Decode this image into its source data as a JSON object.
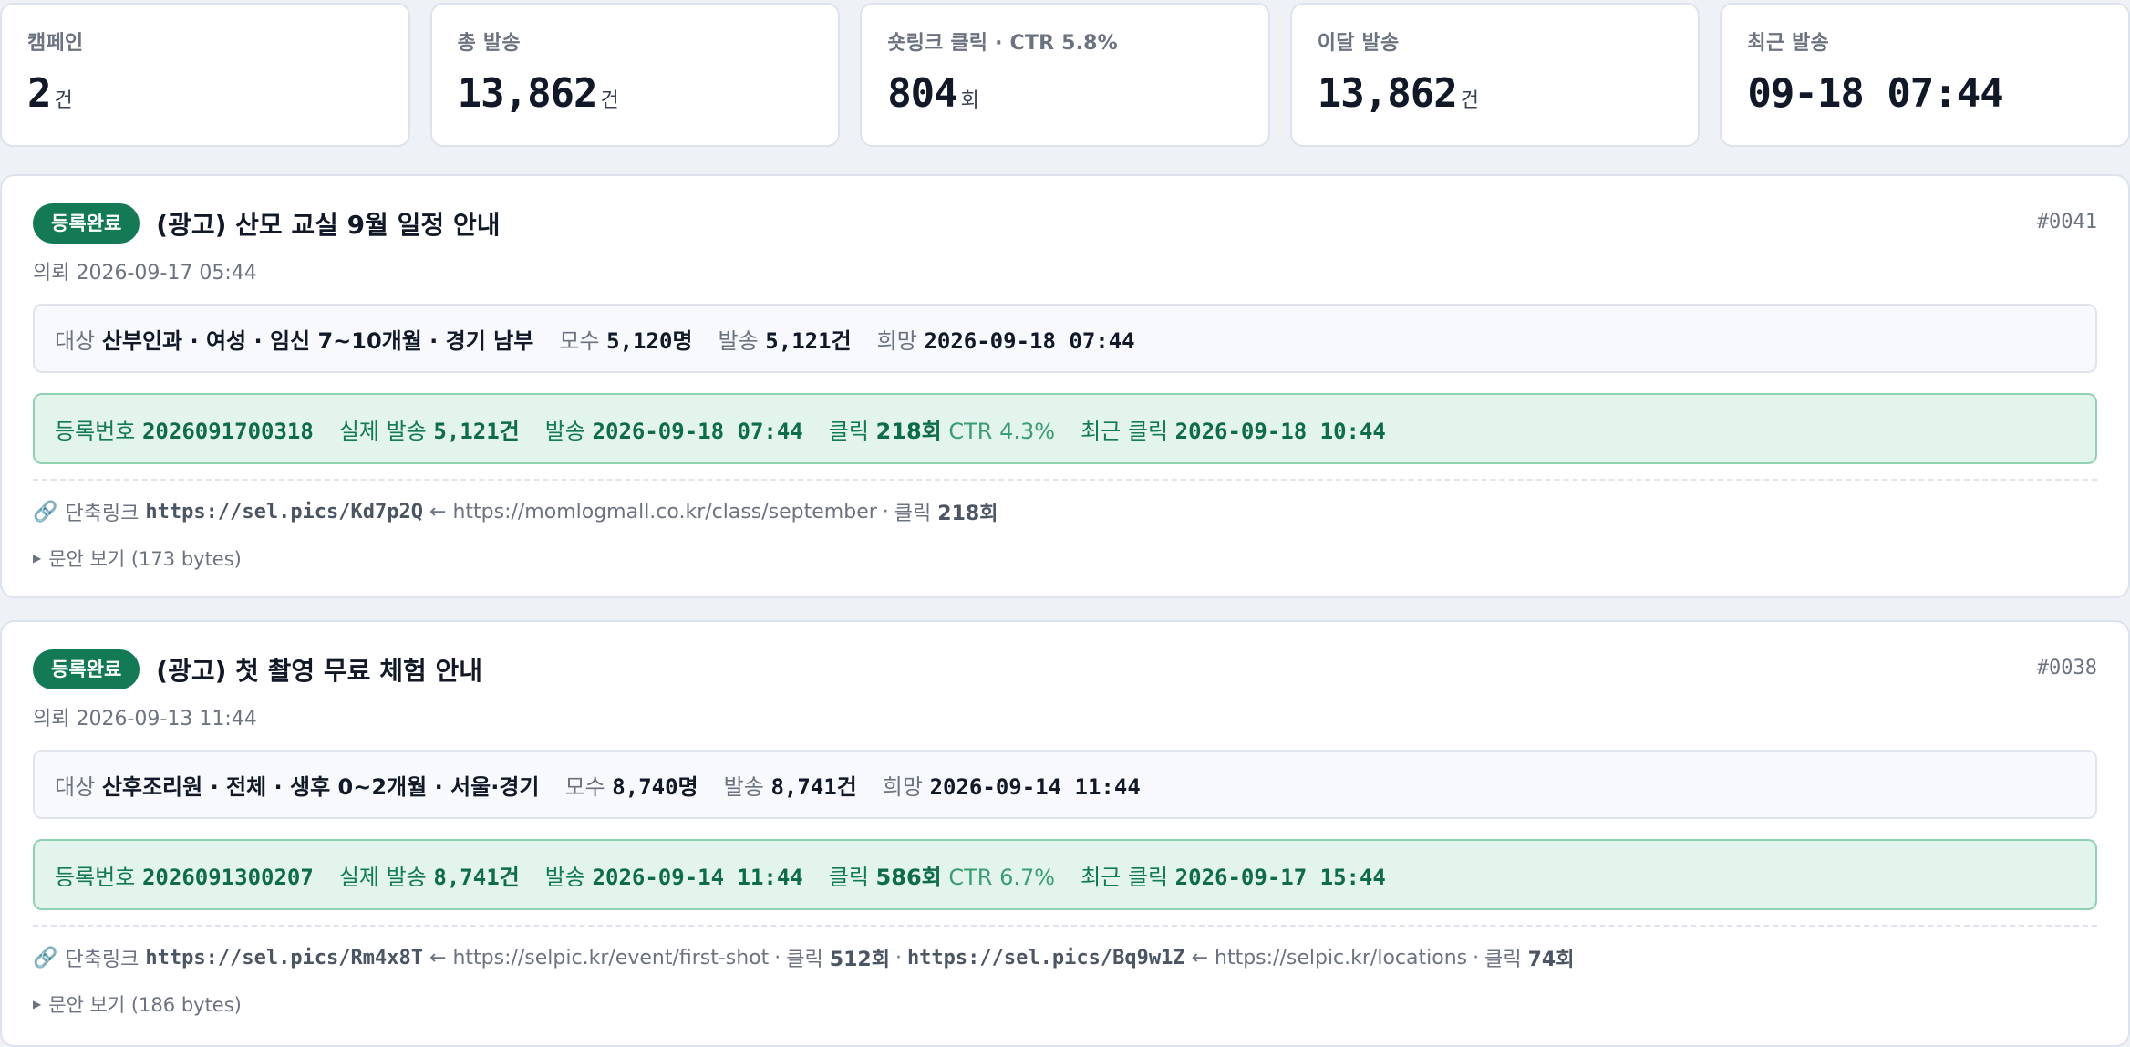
{
  "stats": [
    {
      "label": "캠페인",
      "value": "2",
      "unit": "건"
    },
    {
      "label": "총 발송",
      "value": "13,862",
      "unit": "건"
    },
    {
      "label": "숏링크 클릭 · CTR 5.8%",
      "value": "804",
      "unit": "회"
    },
    {
      "label": "이달 발송",
      "value": "13,862",
      "unit": "건"
    },
    {
      "label": "최근 발송",
      "value": "09-18 07:44",
      "unit": ""
    }
  ],
  "campaigns": [
    {
      "status": "등록완료",
      "title": "(광고) 산모 교실 9월 일정 안내",
      "id": "#0041",
      "requested": "의뢰 2026-09-17 05:44",
      "target_label": "대상",
      "target": "산부인과 · 여성 · 임신 7~10개월 · 경기 남부",
      "population_label": "모수",
      "population": "5,120명",
      "send_label": "발송",
      "send": "5,121건",
      "desired_label": "희망",
      "desired": "2026-09-18 07:44",
      "reg_label": "등록번호",
      "reg_no": "2026091700318",
      "actual_label": "실제 발송",
      "actual": "5,121건",
      "sent_label": "발송",
      "sent_at": "2026-09-18 07:44",
      "click_label": "클릭",
      "clicks": "218회",
      "ctr": "CTR 4.3%",
      "last_click_label": "최근 클릭",
      "last_click": "2026-09-18 10:44",
      "links_label": "단축링크",
      "links": [
        {
          "short": "https://sel.pics/Kd7p2Q",
          "arrow": "←",
          "target": "https://momlogmall.co.kr/class/september",
          "click_label": "클릭",
          "clicks": "218회"
        }
      ],
      "preview": "문안 보기 (173 bytes)"
    },
    {
      "status": "등록완료",
      "title": "(광고) 첫 촬영 무료 체험 안내",
      "id": "#0038",
      "requested": "의뢰 2026-09-13 11:44",
      "target_label": "대상",
      "target": "산후조리원 · 전체 · 생후 0~2개월 · 서울·경기",
      "population_label": "모수",
      "population": "8,740명",
      "send_label": "발송",
      "send": "8,741건",
      "desired_label": "희망",
      "desired": "2026-09-14 11:44",
      "reg_label": "등록번호",
      "reg_no": "2026091300207",
      "actual_label": "실제 발송",
      "actual": "8,741건",
      "sent_label": "발송",
      "sent_at": "2026-09-14 11:44",
      "click_label": "클릭",
      "clicks": "586회",
      "ctr": "CTR 6.7%",
      "last_click_label": "최근 클릭",
      "last_click": "2026-09-17 15:44",
      "links_label": "단축링크",
      "links": [
        {
          "short": "https://sel.pics/Rm4x8T",
          "arrow": "←",
          "target": "https://selpic.kr/event/first-shot",
          "click_label": "클릭",
          "clicks": "512회"
        },
        {
          "short": "https://sel.pics/Bq9w1Z",
          "arrow": "←",
          "target": "https://selpic.kr/locations",
          "click_label": "클릭",
          "clicks": "74회"
        }
      ],
      "preview": "문안 보기 (186 bytes)"
    }
  ],
  "icons": {
    "link": "link-icon",
    "disclosure": "disclosure-triangle-icon"
  },
  "colors": {
    "badge": "#137a55",
    "result_bg": "#e2f4eb",
    "result_text": "#137a55"
  }
}
